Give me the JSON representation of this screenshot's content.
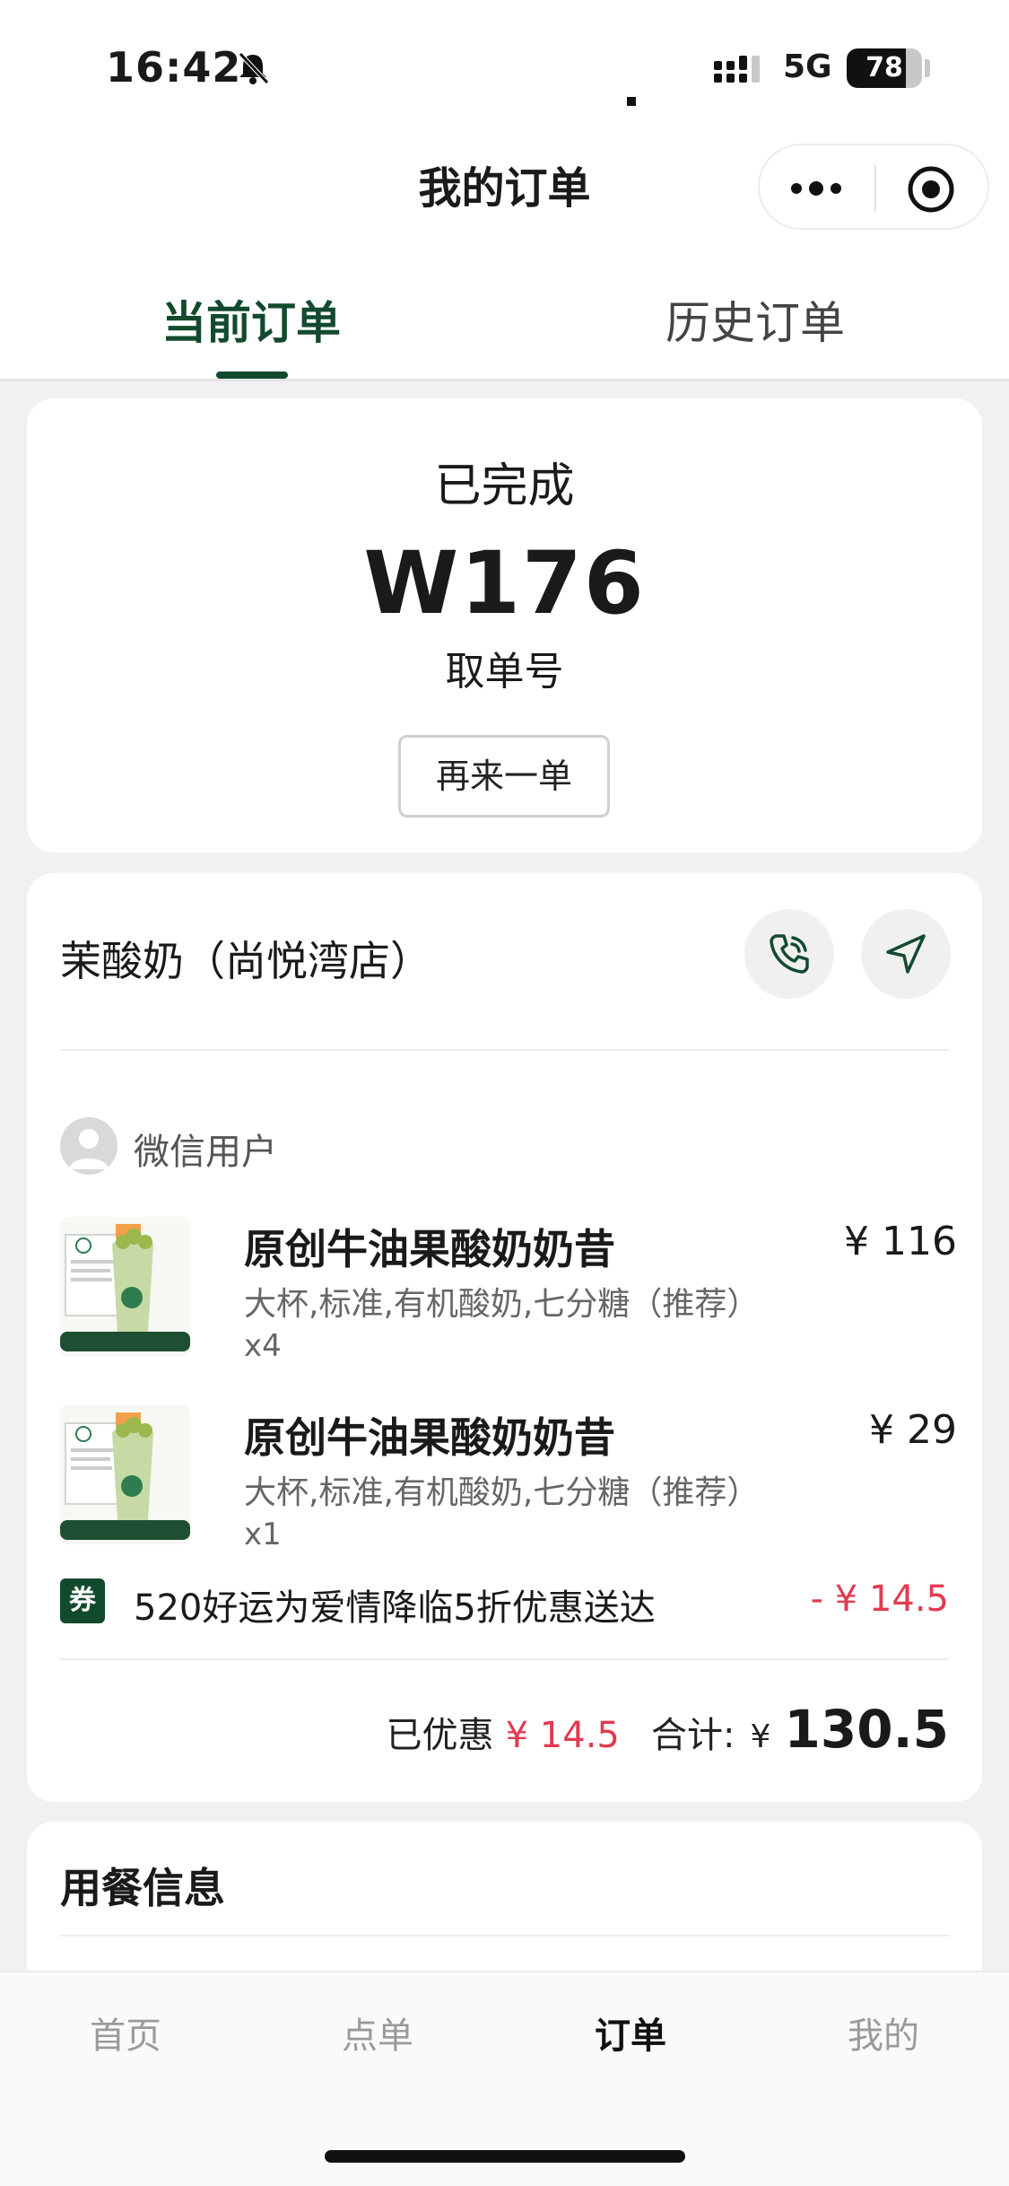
{
  "status_bar": {
    "time": "16:42",
    "network": "5G",
    "battery": "78",
    "battery_level": 0.78
  },
  "header": {
    "title": "我的订单"
  },
  "tabs": {
    "current": "当前订单",
    "history": "历史订单"
  },
  "order_status": {
    "status": "已完成",
    "pickup_number": "W176",
    "pickup_label": "取单号",
    "reorder_label": "再来一单"
  },
  "store": {
    "name": "茉酸奶（尚悦湾店）"
  },
  "user": {
    "name": "微信用户"
  },
  "items": [
    {
      "name": "原创牛油果酸奶奶昔",
      "options": "大杯,标准,有机酸奶,七分糖（推荐）",
      "qty": "x4",
      "price": "¥ 116"
    },
    {
      "name": "原创牛油果酸奶奶昔",
      "options": "大杯,标准,有机酸奶,七分糖（推荐）",
      "qty": "x1",
      "price": "¥ 29"
    }
  ],
  "coupon": {
    "badge": "券",
    "text": "520好运为爱情降临5折优惠送达",
    "amount": "- ¥ 14.5"
  },
  "totals": {
    "discount_label": "已优惠",
    "discount_value": "¥ 14.5",
    "total_label": "合计:",
    "total_currency": "¥",
    "total_value": "130.5"
  },
  "dining": {
    "title": "用餐信息"
  },
  "tab_bar": {
    "home": "首页",
    "menu": "点单",
    "orders": "订单",
    "mine": "我的"
  },
  "colors": {
    "brand_green": "#124a2d",
    "discount_red": "#e33a50"
  }
}
